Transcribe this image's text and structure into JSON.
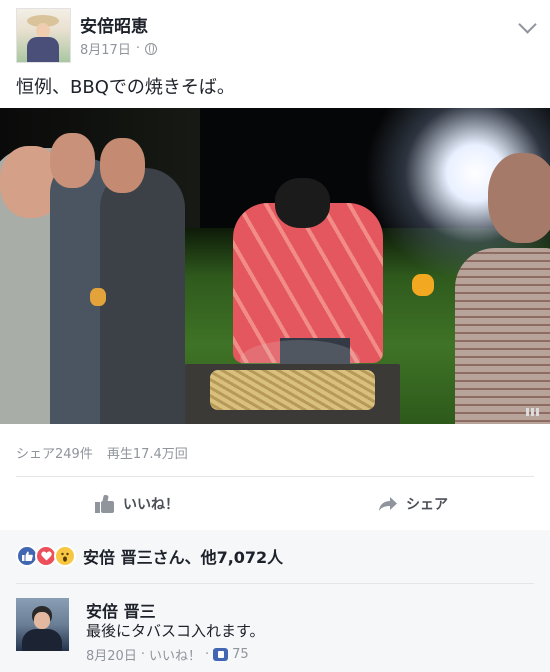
{
  "post": {
    "author": "安倍昭恵",
    "date": "8月17日",
    "separator": "·",
    "text": "恒例、BBQでの焼きそば。",
    "stats": {
      "shares": "シェア249件",
      "views": "再生17.4万回"
    }
  },
  "actions": {
    "like": "いいね！",
    "share": "シェア"
  },
  "reactions": {
    "types": [
      "like",
      "love",
      "wow"
    ],
    "summary": "安倍 晋三さん、他7,072人"
  },
  "comment": {
    "author": "安倍 晋三",
    "text": "最後にタバスコ入れます。",
    "date": "8月20日",
    "separator": "·",
    "like_label": "いいね！",
    "like_sep": "·",
    "like_count": "75"
  }
}
